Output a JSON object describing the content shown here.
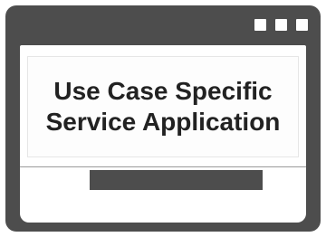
{
  "window": {
    "controls": [
      "square-icon",
      "square-icon",
      "square-icon"
    ]
  },
  "content": {
    "title_line_1": "Use Case Specific",
    "title_line_2": "Service Application"
  },
  "colors": {
    "frame": "#4d4d4d",
    "background": "#ffffff",
    "text": "#222222"
  }
}
